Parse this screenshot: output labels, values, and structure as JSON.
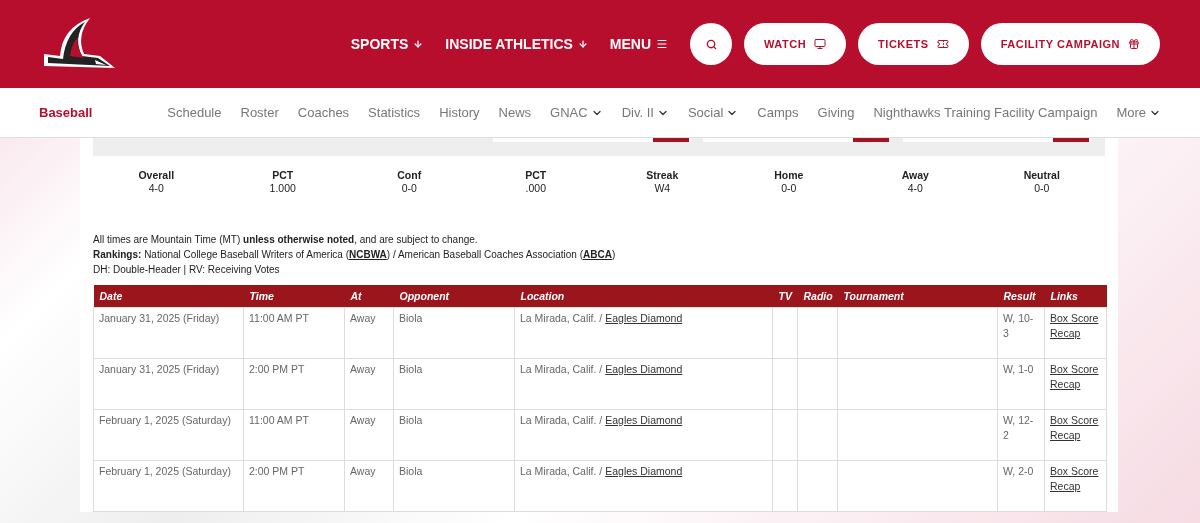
{
  "header": {
    "nav": [
      {
        "label": "SPORTS",
        "kind": "dropdown"
      },
      {
        "label": "INSIDE ATHLETICS",
        "kind": "dropdown"
      },
      {
        "label": "MENU",
        "kind": "menu"
      }
    ],
    "buttons": [
      {
        "kind": "search"
      },
      {
        "kind": "watch",
        "label": "WATCH"
      },
      {
        "kind": "tickets",
        "label": "TICKETS"
      },
      {
        "kind": "gift",
        "label": "FACILITY CAMPAIGN"
      }
    ]
  },
  "subnav": {
    "title": "Baseball",
    "items": [
      {
        "label": "Schedule",
        "dropdown": false
      },
      {
        "label": "Roster",
        "dropdown": false
      },
      {
        "label": "Coaches",
        "dropdown": false
      },
      {
        "label": "Statistics",
        "dropdown": false
      },
      {
        "label": "History",
        "dropdown": false
      },
      {
        "label": "News",
        "dropdown": false
      },
      {
        "label": "GNAC",
        "dropdown": true
      },
      {
        "label": "Div. II",
        "dropdown": true
      },
      {
        "label": "Social",
        "dropdown": true
      },
      {
        "label": "Camps",
        "dropdown": false
      },
      {
        "label": "Giving",
        "dropdown": false
      },
      {
        "label": "Nighthawks Training Facility Campaign",
        "dropdown": false
      },
      {
        "label": "More",
        "dropdown": true
      }
    ]
  },
  "record": [
    {
      "label": "Overall",
      "value": "4-0"
    },
    {
      "label": "PCT",
      "value": "1.000"
    },
    {
      "label": "Conf",
      "value": "0-0"
    },
    {
      "label": "PCT",
      "value": ".000"
    },
    {
      "label": "Streak",
      "value": "W4"
    },
    {
      "label": "Home",
      "value": "0-0"
    },
    {
      "label": "Away",
      "value": "4-0"
    },
    {
      "label": "Neutral",
      "value": "0-0"
    }
  ],
  "notes": {
    "times": "All times are Mountain Time (MT) **unless otherwise noted**, and are subject to change.",
    "rankings_label": "Rankings:",
    "rankings_parts": [
      "National College Baseball Writers of America (",
      "NCBWA",
      ") / American Baseball Coaches Association (",
      "ABCA",
      ")"
    ],
    "legend": "DH: Double-Header | RV: Receiving Votes"
  },
  "table": {
    "columns": [
      "Date",
      "Time",
      "At",
      "Opponent",
      "Location",
      "TV",
      "Radio",
      "Tournament",
      "Result",
      "Links"
    ],
    "rows": [
      {
        "date": "January 31, 2025 (Friday)",
        "time": "11:00 AM PT",
        "at": "Away",
        "opponent": "Biola",
        "city": "La Mirada, Calif. /",
        "venue": "Eagles Diamond",
        "result": "W, 10-3",
        "links": [
          "Box Score",
          "Recap"
        ]
      },
      {
        "date": "January 31, 2025 (Friday)",
        "time": "2:00 PM PT",
        "at": "Away",
        "opponent": "Biola",
        "city": "La Mirada, Calif. /",
        "venue": "Eagles Diamond",
        "result": "W, 1-0",
        "links": [
          "Box Score",
          "Recap"
        ]
      },
      {
        "date": "February 1, 2025 (Saturday)",
        "time": "11:00 AM PT",
        "at": "Away",
        "opponent": "Biola",
        "city": "La Mirada, Calif. /",
        "venue": "Eagles Diamond",
        "result": "W, 12-2",
        "links": [
          "Box Score",
          "Recap"
        ]
      },
      {
        "date": "February 1, 2025 (Saturday)",
        "time": "2:00 PM PT",
        "at": "Away",
        "opponent": "Biola",
        "city": "La Mirada, Calif. /",
        "venue": "Eagles Diamond",
        "result": "W, 2-0",
        "links": [
          "Box Score",
          "Recap"
        ]
      }
    ]
  }
}
